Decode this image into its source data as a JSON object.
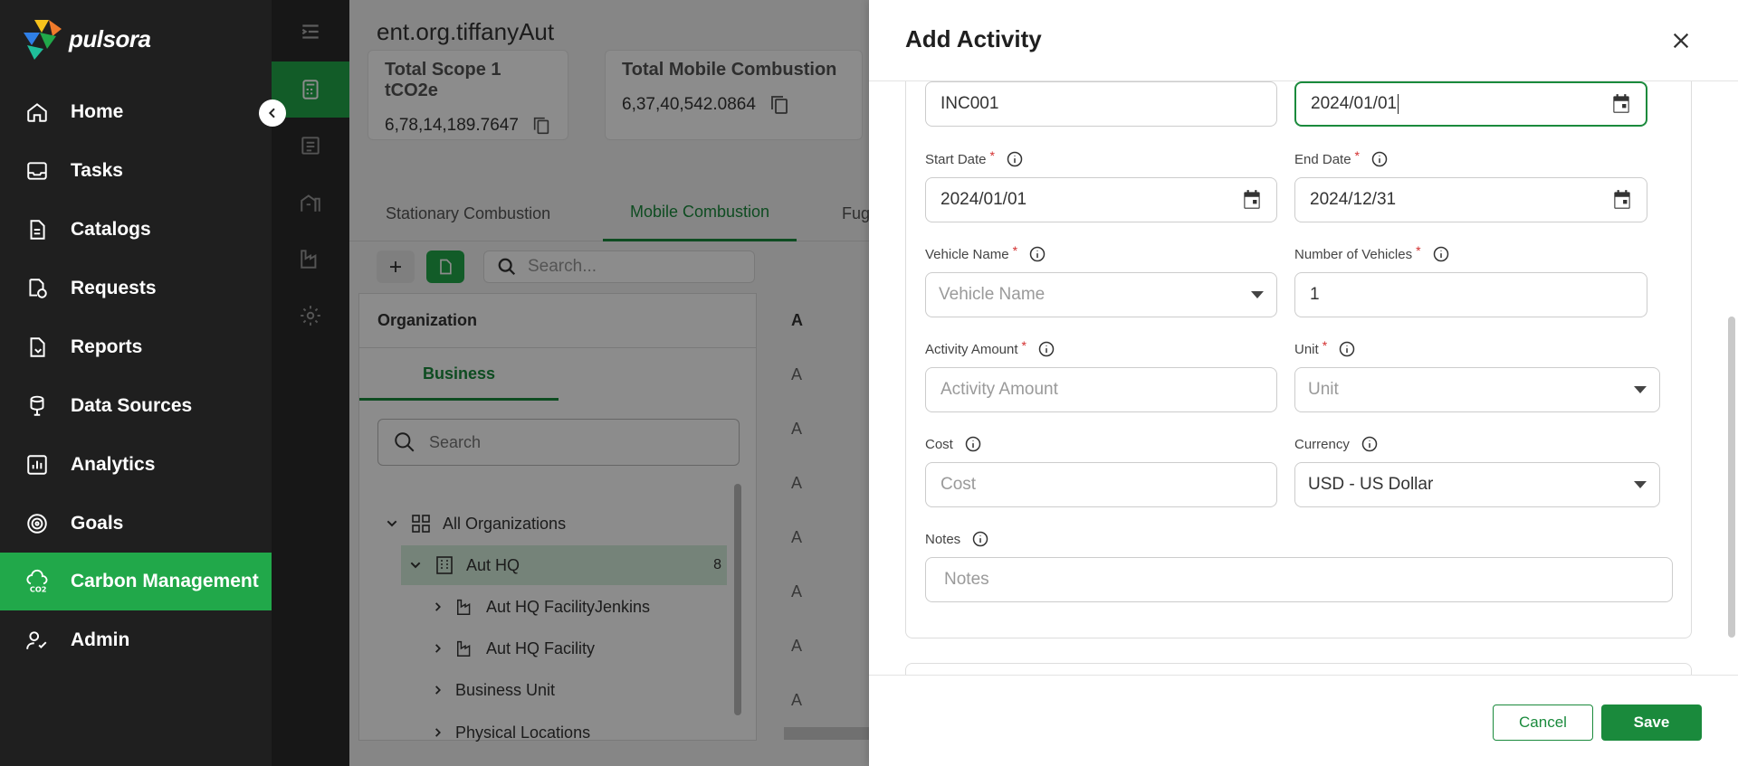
{
  "brand": {
    "name": "pulsora"
  },
  "sidebar": {
    "items": [
      {
        "label": "Home",
        "icon": "home-icon"
      },
      {
        "label": "Tasks",
        "icon": "inbox-icon"
      },
      {
        "label": "Catalogs",
        "icon": "document-icon"
      },
      {
        "label": "Requests",
        "icon": "requests-icon"
      },
      {
        "label": "Reports",
        "icon": "reports-icon"
      },
      {
        "label": "Data Sources",
        "icon": "database-icon"
      },
      {
        "label": "Analytics",
        "icon": "analytics-icon"
      },
      {
        "label": "Goals",
        "icon": "target-icon"
      },
      {
        "label": "Carbon Management",
        "icon": "co2-cloud-icon",
        "active": true
      },
      {
        "label": "Admin",
        "icon": "user-check-icon"
      }
    ]
  },
  "main": {
    "title": "ent.org.tiffanyAut",
    "stats": [
      {
        "label": "Total Scope 1 tCO2e",
        "value": "6,78,14,189.7647"
      },
      {
        "label": "Total Mobile Combustion",
        "value": "6,37,40,542.0864"
      }
    ],
    "tabs": [
      "Stationary Combustion",
      "Mobile Combustion",
      "Fug"
    ],
    "active_tab": "Mobile Combustion",
    "search_placeholder": "Search...",
    "org_panel": {
      "header": "Organization",
      "tab": "Business",
      "search_placeholder": "Search",
      "tree": [
        {
          "label": "All Organizations"
        },
        {
          "label": "Aut HQ",
          "count": "8"
        },
        {
          "label": "Aut HQ FacilityJenkins"
        },
        {
          "label": "Aut HQ Facility"
        },
        {
          "label": "Business Unit"
        },
        {
          "label": "Physical Locations"
        }
      ]
    },
    "right_column": {
      "header": "A",
      "rows": [
        "A",
        "A",
        "A",
        "A",
        "A",
        "A",
        "A"
      ]
    }
  },
  "drawer": {
    "title": "Add Activity",
    "fields": {
      "id_value": "INC001",
      "date_value": "2024/01/01",
      "start_date": {
        "label": "Start Date",
        "value": "2024/01/01"
      },
      "end_date": {
        "label": "End Date",
        "value": "2024/12/31"
      },
      "vehicle_name": {
        "label": "Vehicle Name",
        "placeholder": "Vehicle Name"
      },
      "num_vehicles": {
        "label": "Number of Vehicles",
        "value": "1"
      },
      "activity_amount": {
        "label": "Activity Amount",
        "placeholder": "Activity Amount"
      },
      "unit": {
        "label": "Unit",
        "placeholder": "Unit"
      },
      "cost": {
        "label": "Cost",
        "placeholder": "Cost"
      },
      "currency": {
        "label": "Currency",
        "value": "USD - US Dollar"
      },
      "notes": {
        "label": "Notes",
        "placeholder": "Notes"
      }
    },
    "cancel_label": "Cancel",
    "save_label": "Save"
  },
  "colors": {
    "accent": "#1a8a3c",
    "nav_active": "#21a84a",
    "sidebar_bg": "#1f1f1f",
    "required": "#d32f2f"
  }
}
